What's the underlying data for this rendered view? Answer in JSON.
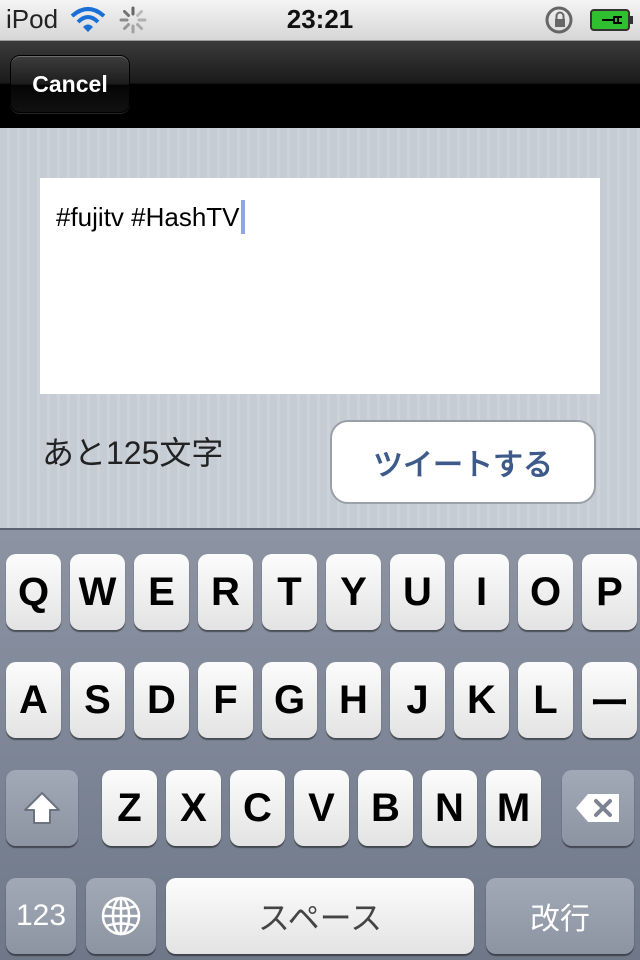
{
  "status_bar": {
    "carrier": "iPod",
    "time": "23:21"
  },
  "nav": {
    "cancel_label": "Cancel"
  },
  "compose": {
    "text": "#fujitv #HashTV",
    "remaining": "あと125文字",
    "tweet_label": "ツイートする"
  },
  "keyboard": {
    "row1": [
      "Q",
      "W",
      "E",
      "R",
      "T",
      "Y",
      "U",
      "I",
      "O",
      "P"
    ],
    "row2": [
      "A",
      "S",
      "D",
      "F",
      "G",
      "H",
      "J",
      "K",
      "L",
      "ー"
    ],
    "row3": [
      "Z",
      "X",
      "C",
      "V",
      "B",
      "N",
      "M"
    ],
    "numbers_label": "123",
    "space_label": "スペース",
    "return_label": "改行"
  }
}
